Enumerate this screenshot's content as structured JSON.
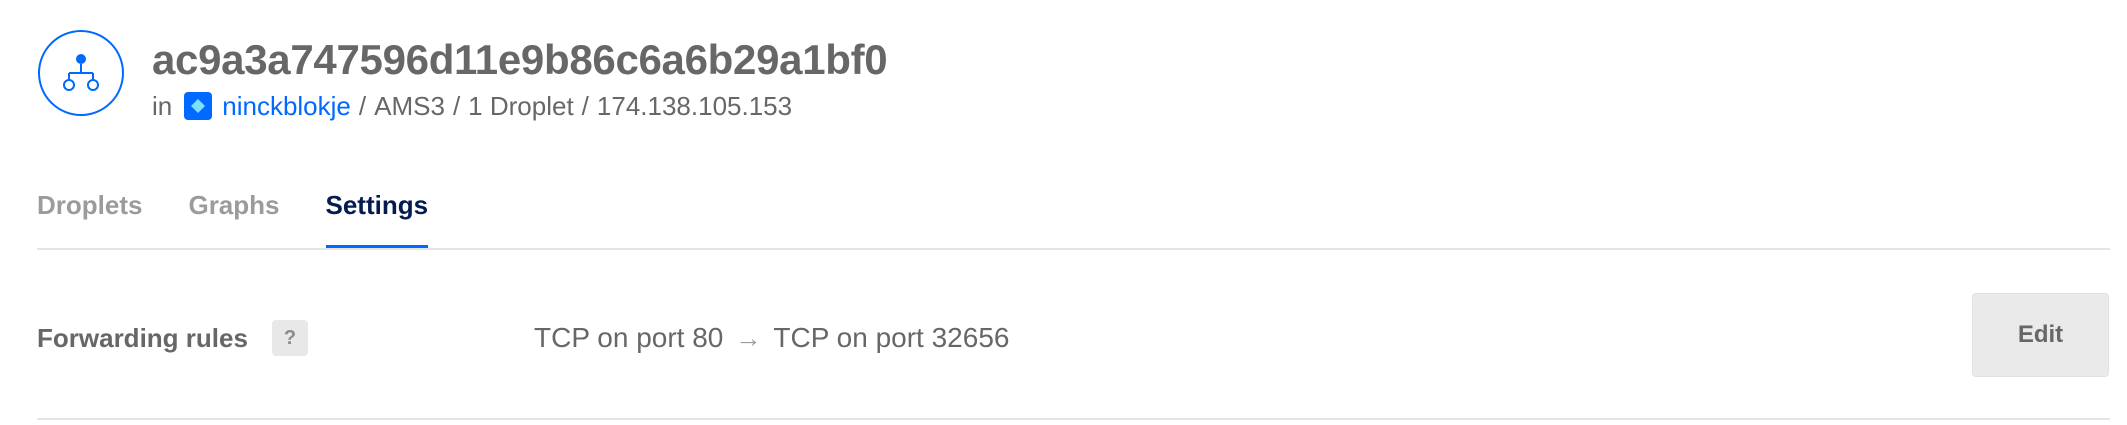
{
  "header": {
    "icon": "load-balancer-icon",
    "title": "ac9a3a747596d11e9b86c6a6b29a1bf0",
    "in_label": "in",
    "project_icon": "project-icon",
    "project_name": "ninckblokje",
    "region": "AMS3",
    "droplet_count": "1 Droplet",
    "ip": "174.138.105.153"
  },
  "tabs": [
    {
      "label": "Droplets",
      "active": false
    },
    {
      "label": "Graphs",
      "active": false
    },
    {
      "label": "Settings",
      "active": true
    }
  ],
  "settings": {
    "forwarding_rules": {
      "label": "Forwarding rules",
      "help_label": "?",
      "from": "TCP on port 80",
      "arrow": "→",
      "to": "TCP on port 32656",
      "edit_label": "Edit"
    }
  },
  "colors": {
    "accent": "#0069ff",
    "active_tab_text": "#031b4e",
    "text": "#676767",
    "muted": "#9b9b9b"
  }
}
